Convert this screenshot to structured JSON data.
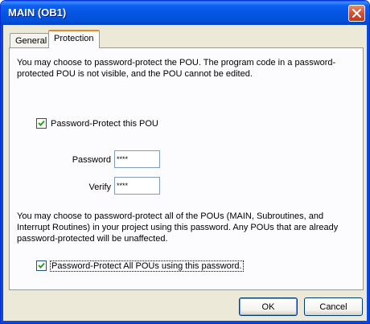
{
  "window": {
    "title": "MAIN (OB1)"
  },
  "tabs": [
    {
      "label": "General",
      "active": false
    },
    {
      "label": "Protection",
      "active": true
    }
  ],
  "protection": {
    "intro_text": "You may choose to password-protect the POU.  The program code in a password-protected POU is not visible, and the POU cannot be edited.",
    "protect_pou": {
      "label": "Password-Protect this POU",
      "checked": true
    },
    "password": {
      "label": "Password",
      "value": "****"
    },
    "verify": {
      "label": "Verify",
      "value": "****"
    },
    "all_text": "You may choose to password-protect all of the POUs (MAIN, Subroutines, and Interrupt Routines) in your project using this password.  Any POUs that are already password-protected will be unaffected.",
    "protect_all": {
      "label": "Password-Protect All POUs using this password.",
      "checked": true
    }
  },
  "buttons": {
    "ok": "OK",
    "cancel": "Cancel"
  },
  "icons": {
    "close": "close-icon",
    "check": "checkmark-icon"
  },
  "colors": {
    "titlebar": "#0454e0",
    "tab_highlight": "#e68b2c",
    "dialog_bg": "#ece9d8"
  }
}
